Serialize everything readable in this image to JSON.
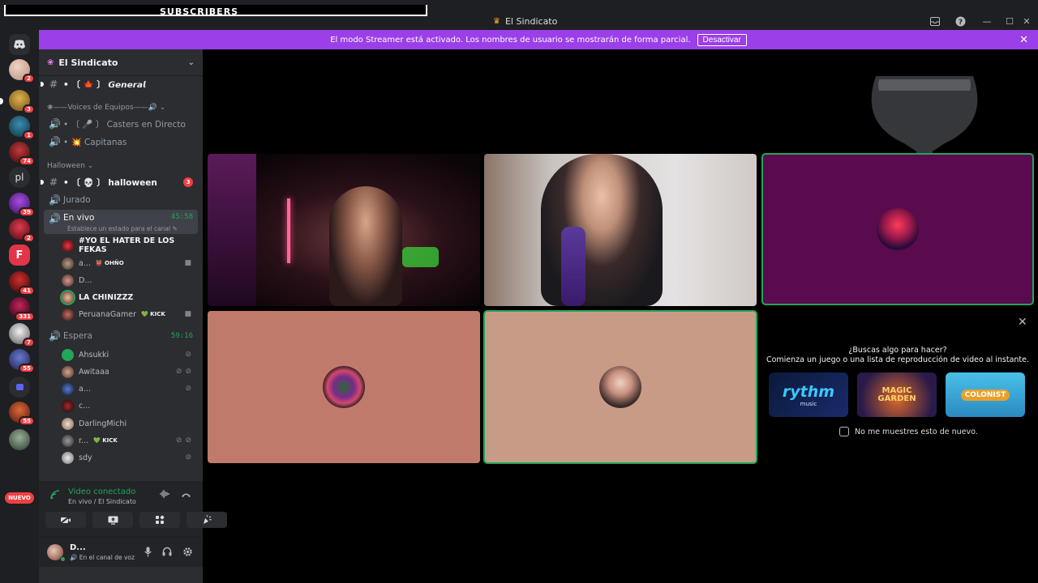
{
  "window": {
    "title": "El Sindicato",
    "overlay_text": "SUBSCRIBERS",
    "controls": [
      "inbox-icon",
      "help-icon",
      "minimize-icon",
      "maximize-icon",
      "close-icon"
    ]
  },
  "banner": {
    "message": "El modo Streamer está activado. Los nombres de usuario se mostrarán de forma parcial.",
    "button": "Desactivar",
    "close": "✕"
  },
  "rail": {
    "badges": [
      "2",
      "3",
      "1",
      "74",
      "39",
      "2",
      "41",
      "331",
      "7",
      "55",
      "55"
    ],
    "text_server": "pl",
    "new_label": "NUEVO"
  },
  "guild": {
    "name": "El Sindicato"
  },
  "channels": {
    "general": "• 〔 🍁 〕 𝙂𝙚𝙣𝙚𝙧𝙖𝙡",
    "category_voices": "❀——Voices de Equipos——🔊",
    "casters": "• 〔 🎤 〕 Casters en Directo",
    "capitanas": "• 💥 Capitanas",
    "category_halloween": "Halloween",
    "halloween": "• 〔 💀 〕 halloween",
    "halloween_mentions": "3",
    "jurado": "Jurado",
    "en_vivo": "En vivo",
    "en_vivo_timer": "45:58",
    "en_vivo_status": "Establece un estado para el canal ✎",
    "espera": "Espera",
    "espera_timer": "59:16"
  },
  "en_vivo_users": [
    {
      "name": "#YO EL HATER DE LOS FEKAS",
      "tag": ""
    },
    {
      "name": "a...",
      "tag": "👹 OHÑO"
    },
    {
      "name": "D...",
      "tag": ""
    },
    {
      "name": "LA CHINIZZZ",
      "tag": ""
    },
    {
      "name": "PeruanaGamer",
      "tag": "💚 KICK"
    }
  ],
  "espera_users": [
    {
      "name": "Ahsukki",
      "tag": ""
    },
    {
      "name": "Awitaaa",
      "tag": ""
    },
    {
      "name": "a...",
      "tag": ""
    },
    {
      "name": "c...",
      "tag": ""
    },
    {
      "name": "DarlingMichi",
      "tag": ""
    },
    {
      "name": "r...",
      "tag": "💚 KICK"
    },
    {
      "name": "sdy",
      "tag": ""
    }
  ],
  "voice_panel": {
    "title": "Video conectado",
    "subtitle": "En vivo / El Sindicato"
  },
  "user_panel": {
    "name": "D...",
    "status": "🔊 En el canal de voz"
  },
  "activity": {
    "question": "¿Buscas algo para hacer?",
    "suggestion": "Comienza un juego o una lista de reproducción de video al instante.",
    "cards": [
      "rythm",
      "MAGIC GARDEN",
      "COLONIST"
    ],
    "card_subtitle": "music",
    "dont_show": "No me muestres esto de nuevo."
  },
  "colors": {
    "accent_banner": "#9b3fe8",
    "speaking": "#23a55a",
    "mention": "#f23f43",
    "tile_purple": "#5a0a4e",
    "tile_salmon": "#c07a6c",
    "tile_peach": "#c89b86"
  }
}
